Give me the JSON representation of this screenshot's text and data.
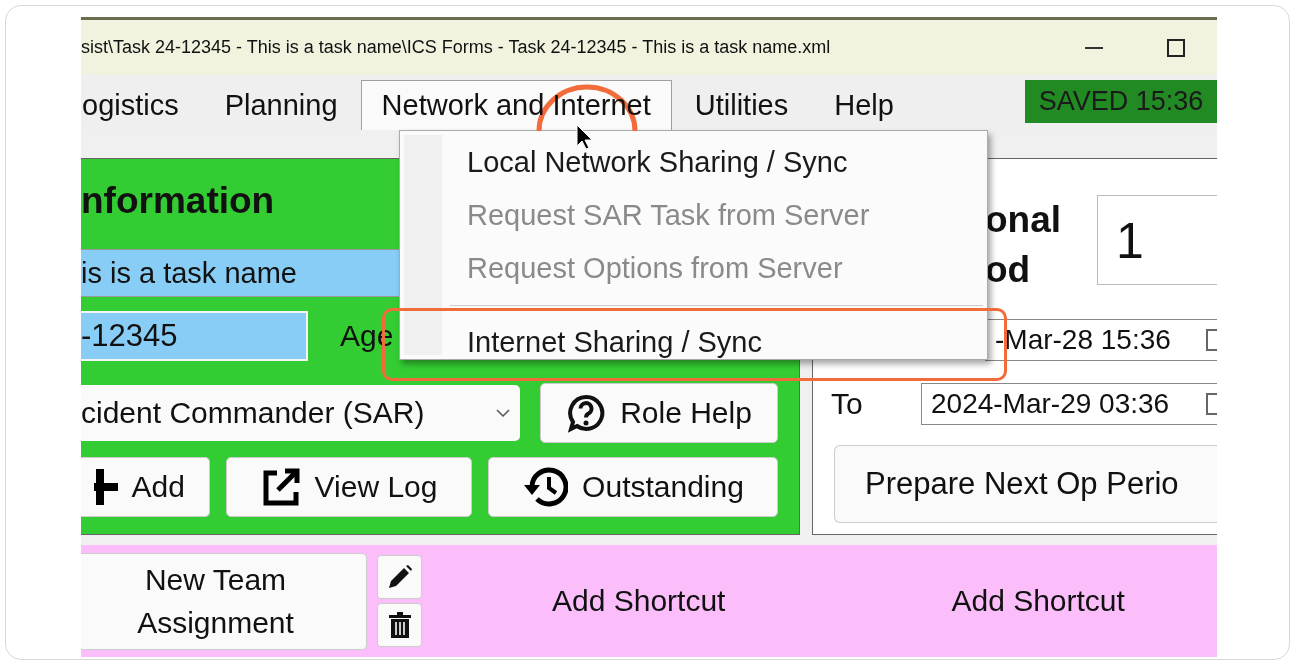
{
  "window": {
    "title": "sist\\Task 24-12345 - This is a task name\\ICS Forms - Task 24-12345 - This is a task name.xml"
  },
  "menu_bar": {
    "items": [
      {
        "label": "ogistics",
        "selected": false
      },
      {
        "label": "Planning",
        "selected": false
      },
      {
        "label": "Network and Internet",
        "selected": true
      },
      {
        "label": "Utilities",
        "selected": false
      },
      {
        "label": "Help",
        "selected": false
      }
    ],
    "save_status": "SAVED 15:36"
  },
  "open_menu": {
    "items": [
      {
        "label": "Local Network Sharing / Sync",
        "disabled": false,
        "separator_before": false,
        "annotated": false
      },
      {
        "label": "Request SAR Task from Server",
        "disabled": true,
        "separator_before": false,
        "annotated": false
      },
      {
        "label": "Request Options from Server",
        "disabled": true,
        "separator_before": false,
        "annotated": false
      },
      {
        "label": "Internet Sharing / Sync",
        "disabled": false,
        "separator_before": true,
        "annotated": true
      }
    ]
  },
  "task_panel": {
    "heading": "nformation",
    "task_name": "is is a task name",
    "task_number": "-12345",
    "agency_label": "Age",
    "role": "cident Commander (SAR)",
    "role_button": {
      "label": "Role Help"
    },
    "buttons": [
      {
        "label": "Add"
      },
      {
        "label": "View Log"
      },
      {
        "label": "Outstanding"
      }
    ]
  },
  "op_period": {
    "heading_lines": [
      "onal",
      "od"
    ],
    "number": "1",
    "from_value": "-Mar-28 15:36",
    "to_label": "To",
    "to_value": "2024-Mar-29 03:36",
    "prepare_button": "Prepare Next Op Perio"
  },
  "shortcuts": {
    "assignment_button": "New Team Assignment",
    "add_shortcuts": [
      "Add Shortcut",
      "Add Shortcut"
    ]
  }
}
